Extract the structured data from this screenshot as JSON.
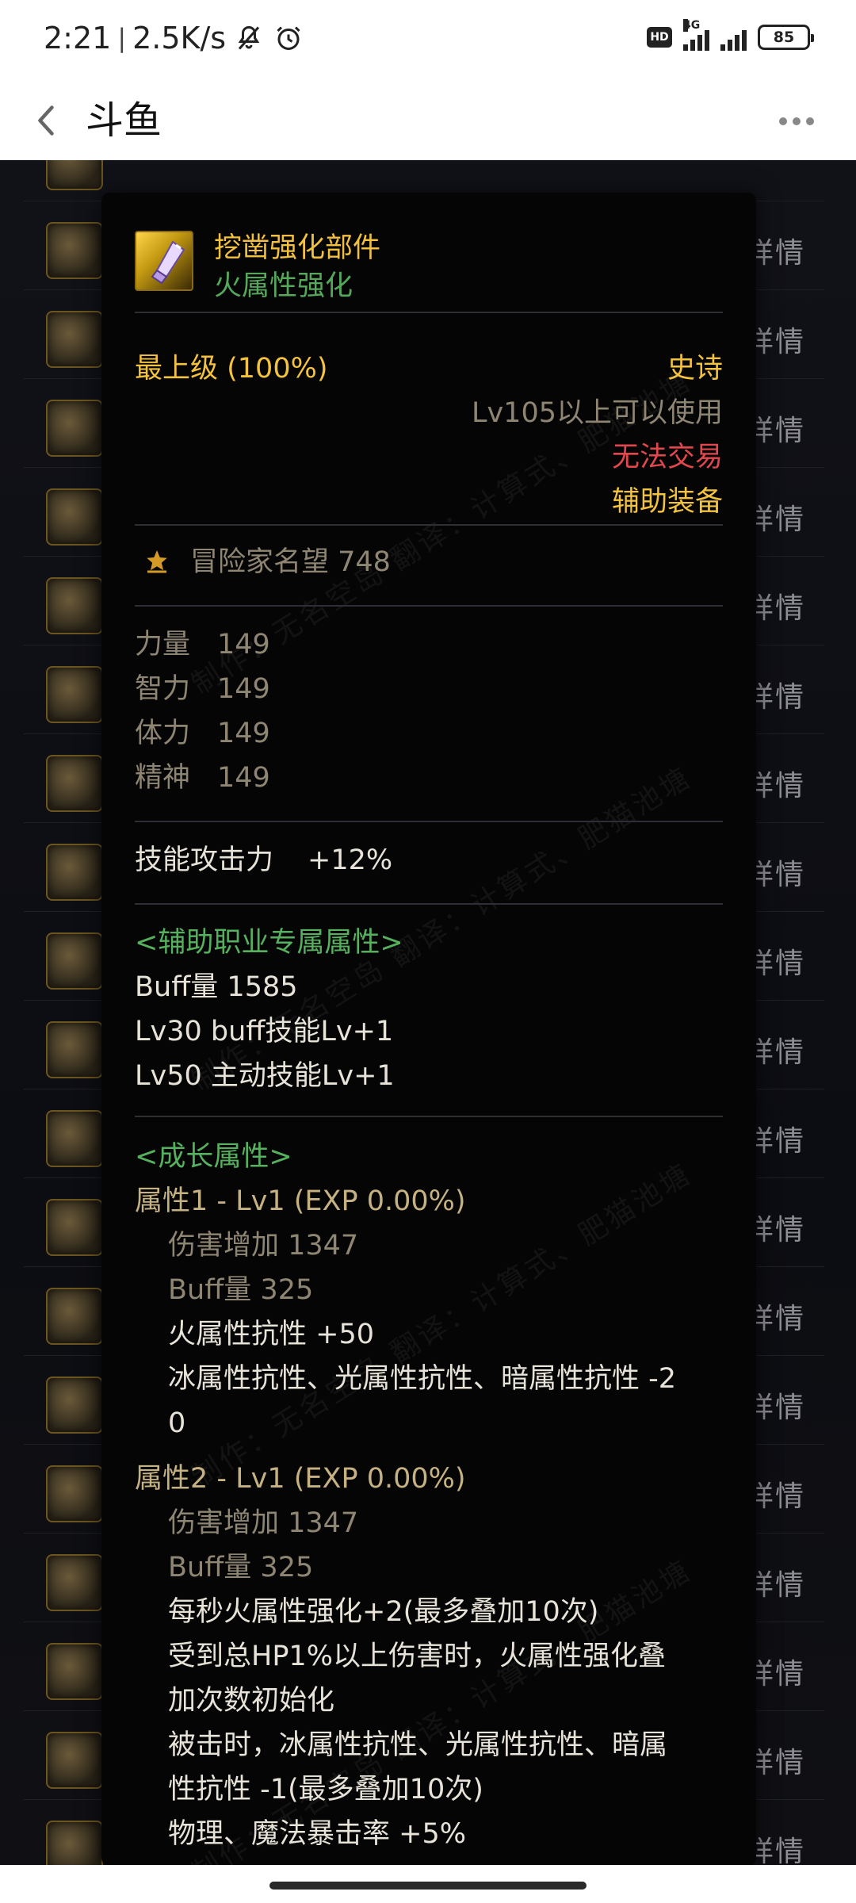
{
  "status_bar": {
    "time": "2:21",
    "separator": "|",
    "speed": "2.5K/s",
    "network": "4G",
    "battery": "85"
  },
  "nav": {
    "title": "斗鱼"
  },
  "list": {
    "detail_label": "详情"
  },
  "tooltip": {
    "item_name": "挖凿强化部件",
    "item_subtitle": "火属性强化",
    "grade": "最上级 (100%)",
    "rarity": "史诗",
    "level_req": "Lv105以上可以使用",
    "trade": "无法交易",
    "slot_type": "辅助装备",
    "fame": "冒险家名望 748",
    "stats": [
      {
        "name": "力量",
        "value": "149"
      },
      {
        "name": "智力",
        "value": "149"
      },
      {
        "name": "体力",
        "value": "149"
      },
      {
        "name": "精神",
        "value": "149"
      }
    ],
    "skill_attack": {
      "name": "技能攻击力",
      "value": "+12%"
    },
    "support_header": "<辅助职业专属属性>",
    "support_lines": [
      "Buff量   1585",
      "Lv30 buff技能Lv+1",
      "Lv50 主动技能Lv+1"
    ],
    "growth_header": "<成长属性>",
    "attr1": {
      "title": "属性1 - Lv1 (EXP 0.00%)",
      "damage": "伤害增加   1347",
      "buff": "Buff量   325",
      "line1": "火属性抗性 +50",
      "line2a": "冰属性抗性、光属性抗性、暗属性抗性 -2",
      "line2b": "0"
    },
    "attr2": {
      "title": "属性2 - Lv1 (EXP 0.00%)",
      "damage": "伤害增加   1347",
      "buff": "Buff量   325",
      "line1": "每秒火属性强化+2(最多叠加10次)",
      "line2a": "受到总HP1%以上伤害时，火属性强化叠",
      "line2b": "加次数初始化",
      "line3a": "被击时，冰属性抗性、光属性抗性、暗属",
      "line3b": "性抗性 -1(最多叠加10次)",
      "line4": "物理、魔法暴击率 +5%"
    },
    "watermark": "制作：无名空岛 翻译：计算式、肥猫池塘"
  }
}
